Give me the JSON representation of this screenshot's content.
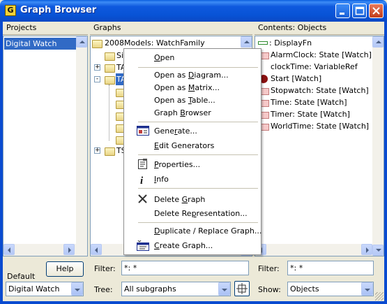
{
  "window": {
    "title": "Graph Browser",
    "app_icon_glyph": "G"
  },
  "panes": {
    "projects": {
      "header": "Projects",
      "items": [
        "Digital Watch"
      ],
      "selected": "Digital Watch"
    },
    "graphs": {
      "header": "Graphs",
      "root": "2008Models: WatchFamily",
      "children": [
        {
          "label": "Si",
          "indent": 1,
          "expander": ""
        },
        {
          "label": "TA",
          "indent": 1,
          "expander": "+"
        },
        {
          "label": "TA",
          "indent": 1,
          "expander": "-",
          "selected": true
        },
        {
          "label": "",
          "indent": 2,
          "expander": ""
        },
        {
          "label": "",
          "indent": 2,
          "expander": ""
        },
        {
          "label": "",
          "indent": 2,
          "expander": ""
        },
        {
          "label": "",
          "indent": 2,
          "expander": ""
        },
        {
          "label": "",
          "indent": 2,
          "expander": ""
        },
        {
          "label": "TS",
          "indent": 1,
          "expander": "+"
        }
      ]
    },
    "contents": {
      "header": "Contents: Objects",
      "items": [
        {
          "label": ": DisplayFn",
          "icon": "displayfn-icon"
        },
        {
          "label": "AlarmClock: State [Watch]",
          "icon": "state-icon"
        },
        {
          "label": "clockTime: VariableRef",
          "icon": ""
        },
        {
          "label": "Start [Watch]",
          "icon": "start-state-icon"
        },
        {
          "label": "Stopwatch: State [Watch]",
          "icon": "state-icon"
        },
        {
          "label": "Time: State [Watch]",
          "icon": "state-icon"
        },
        {
          "label": "Timer: State [Watch]",
          "icon": "state-icon"
        },
        {
          "label": "WorldTime: State [Watch]",
          "icon": "state-icon"
        }
      ]
    }
  },
  "context_menu": {
    "groups": [
      [
        {
          "label": "Open",
          "u": "O",
          "rest": "pen"
        }
      ],
      [
        {
          "label": "Open as Diagram...",
          "pre": "Open as ",
          "u": "D",
          "rest": "iagram..."
        },
        {
          "label": "Open as Matrix...",
          "pre": "Open as ",
          "u": "M",
          "rest": "atrix..."
        },
        {
          "label": "Open as Table...",
          "pre": "Open as ",
          "u": "T",
          "rest": "able..."
        },
        {
          "label": "Graph Browser",
          "pre": "Graph ",
          "u": "B",
          "rest": "rowser"
        }
      ],
      [
        {
          "label": "Generate...",
          "pre": "Gene",
          "u": "r",
          "rest": "ate...",
          "icon": "generate-icon"
        },
        {
          "label": "Edit Generators",
          "u": "E",
          "rest": "dit Generators"
        }
      ],
      [
        {
          "label": "Properties...",
          "u": "P",
          "rest": "roperties...",
          "icon": "properties-icon"
        },
        {
          "label": "Info",
          "u": "I",
          "rest": "nfo",
          "icon": "info-icon"
        }
      ],
      [
        {
          "label": "Delete Graph",
          "pre": "Delete ",
          "u": "G",
          "rest": "raph",
          "icon": "delete-icon"
        },
        {
          "label": "Delete Representation...",
          "pre": "Delete Re",
          "u": "p",
          "rest": "resentation..."
        }
      ],
      [
        {
          "label": "Duplicate / Replace Graph...",
          "u": "D",
          "rest": "uplicate / Replace Graph..."
        },
        {
          "label": "Create Graph...",
          "u": "C",
          "rest": "reate Graph...",
          "icon": "create-graph-icon"
        }
      ]
    ]
  },
  "bottom": {
    "default_label": "Default",
    "help_button": "Help",
    "project_combo": "Digital Watch",
    "graphs_filter_label": "Filter:",
    "graphs_filter_value": "*: *",
    "tree_label": "Tree:",
    "tree_combo": "All subgraphs",
    "contents_filter_label": "Filter:",
    "contents_filter_value": "*: *",
    "show_label": "Show:",
    "show_combo": "Objects"
  },
  "colors": {
    "selection": "#316ac5",
    "titlebar": "#0853d6"
  }
}
